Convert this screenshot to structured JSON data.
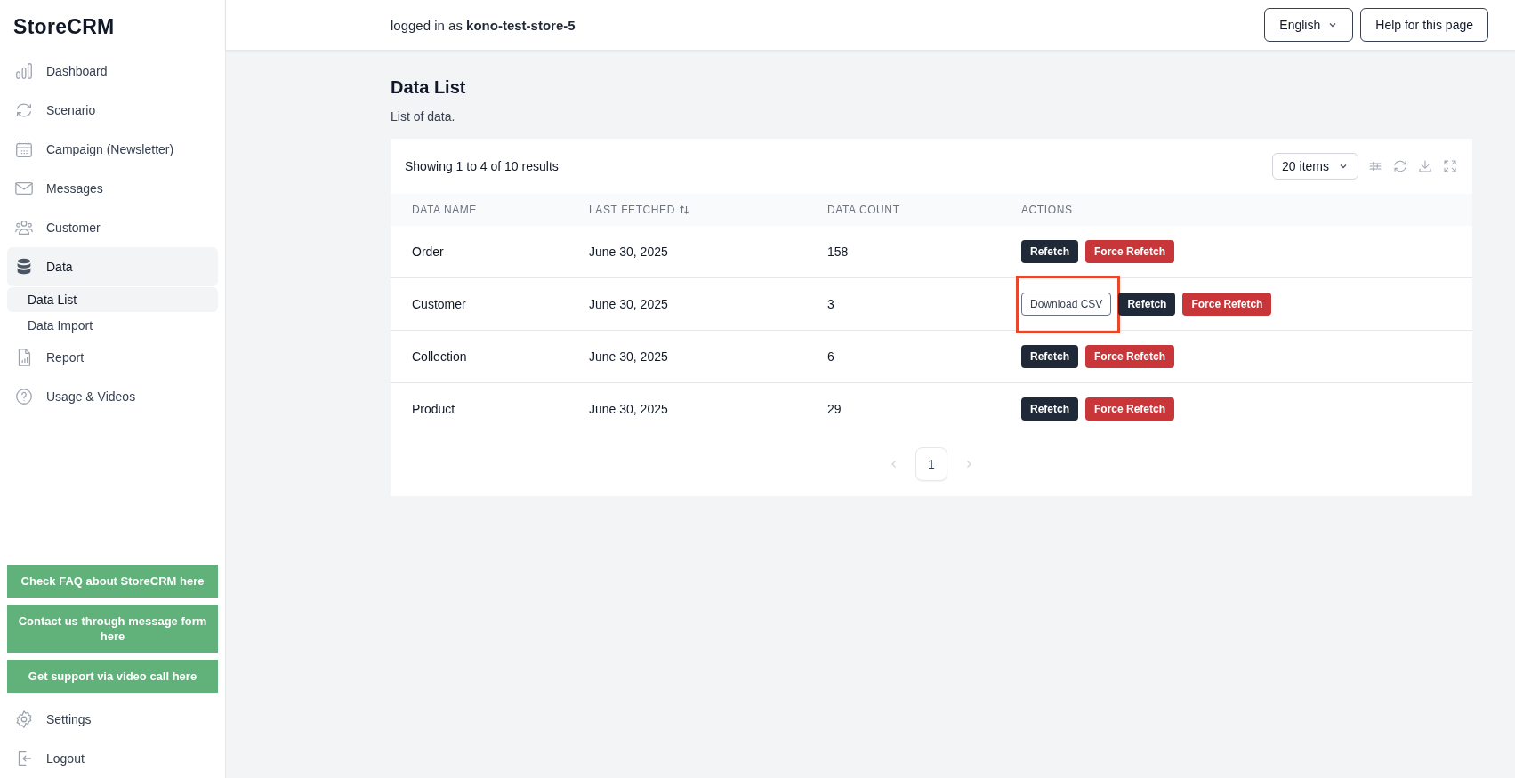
{
  "brand": "StoreCRM",
  "sidebar": {
    "items": [
      {
        "label": "Dashboard",
        "selected": false
      },
      {
        "label": "Scenario",
        "selected": false
      },
      {
        "label": "Campaign (Newsletter)",
        "selected": false
      },
      {
        "label": "Messages",
        "selected": false
      },
      {
        "label": "Customer",
        "selected": false
      },
      {
        "label": "Data",
        "selected": true,
        "children": [
          {
            "label": "Data List",
            "selected": true
          },
          {
            "label": "Data Import",
            "selected": false
          }
        ]
      },
      {
        "label": "Report",
        "selected": false
      },
      {
        "label": "Usage & Videos",
        "selected": false
      }
    ],
    "help_links": [
      "Check FAQ about StoreCRM here",
      "Contact us through message form here",
      "Get support via video call here"
    ],
    "bottom_items": [
      {
        "label": "Settings"
      },
      {
        "label": "Logout"
      }
    ]
  },
  "header": {
    "login_prefix": "logged in as",
    "store": "kono-test-store-5",
    "language": "English",
    "help_button": "Help for this page"
  },
  "page": {
    "title": "Data List",
    "subtitle": "List of data."
  },
  "table": {
    "summary": "Showing 1 to 4 of 10 results",
    "page_size": "20 items",
    "columns": [
      {
        "label": "DATA NAME",
        "sortable": false
      },
      {
        "label": "LAST FETCHED",
        "sortable": true
      },
      {
        "label": "DATA COUNT",
        "sortable": false
      },
      {
        "label": "ACTIONS",
        "sortable": false
      }
    ],
    "rows": [
      {
        "name": "Order",
        "last_fetched": "June 30, 2025",
        "count": "158",
        "actions": [
          {
            "kind": "refetch",
            "label": "Refetch"
          },
          {
            "kind": "force",
            "label": "Force Refetch"
          }
        ]
      },
      {
        "name": "Customer",
        "last_fetched": "June 30, 2025",
        "count": "3",
        "actions": [
          {
            "kind": "download",
            "label": "Download CSV",
            "highlighted": true
          },
          {
            "kind": "refetch",
            "label": "Refetch"
          },
          {
            "kind": "force",
            "label": "Force Refetch"
          }
        ]
      },
      {
        "name": "Collection",
        "last_fetched": "June 30, 2025",
        "count": "6",
        "actions": [
          {
            "kind": "refetch",
            "label": "Refetch"
          },
          {
            "kind": "force",
            "label": "Force Refetch"
          }
        ]
      },
      {
        "name": "Product",
        "last_fetched": "June 30, 2025",
        "count": "29",
        "actions": [
          {
            "kind": "refetch",
            "label": "Refetch"
          },
          {
            "kind": "force",
            "label": "Force Refetch"
          }
        ]
      }
    ],
    "pages": [
      {
        "label": "1",
        "selected": true
      }
    ]
  }
}
